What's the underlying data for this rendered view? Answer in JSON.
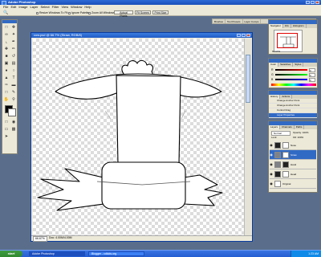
{
  "app_title": "Adobe Photoshop",
  "menu": [
    "File",
    "Edit",
    "Image",
    "Layer",
    "Select",
    "Filter",
    "View",
    "Window",
    "Help"
  ],
  "options": {
    "resize_windows": "Resize Windows To Fit",
    "ignore_palettes": "Ignore Palettes",
    "zoom_all": "Zoom All Windows",
    "actual_pixels": "Actual Pixels",
    "fit_screen": "Fit Screen",
    "print_size": "Print Size"
  },
  "palette_well": [
    "Brushes",
    "Tool Presets",
    "Layer Comps"
  ],
  "document": {
    "title": "cow.psd @ 66.7% (Straw, RGB/8)",
    "zoom": "66.67%",
    "doc_size": "Doc: 4.00M/4.00M"
  },
  "navigator": {
    "tabs": [
      "Navigator",
      "Info",
      "Histogram"
    ],
    "zoom": "66.67%"
  },
  "color": {
    "tabs": [
      "Color",
      "Swatches",
      "Styles"
    ],
    "channels": [
      "R",
      "G",
      "B"
    ],
    "values": [
      "0",
      "0",
      "0"
    ]
  },
  "history": {
    "tabs": [
      "History",
      "Actions"
    ],
    "items": [
      "Change Anchor Point",
      "Change Anchor Point",
      "Control Drag",
      "Layer Properties"
    ]
  },
  "layers": {
    "tabs": [
      "Layers",
      "Channels",
      "Paths"
    ],
    "blend_mode": "Normal",
    "opacity": "Opacity: 100%",
    "fill": "Fill: 100%",
    "lock": "Lock:",
    "items": [
      {
        "name": "Nose"
      },
      {
        "name": "Straw"
      },
      {
        "name": "Hand"
      },
      {
        "name": "Head"
      },
      {
        "name": "Original"
      }
    ]
  },
  "taskbar": {
    "start": "start",
    "tasks": [
      "Adobe Photoshop",
      "Blogger - cdkids.org"
    ],
    "time": "1:23 AM"
  }
}
